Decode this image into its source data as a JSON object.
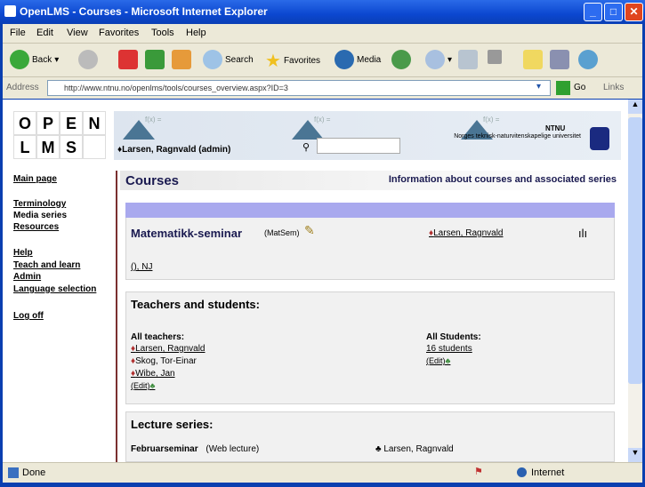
{
  "window": {
    "title": "OpenLMS - Courses - Microsoft Internet Explorer"
  },
  "menu": [
    "File",
    "Edit",
    "View",
    "Favorites",
    "Tools",
    "Help"
  ],
  "toolbar": {
    "back": "Back",
    "search": "Search",
    "favorites": "Favorites",
    "media": "Media"
  },
  "address": {
    "label": "Address",
    "url": "http://www.ntnu.no/openlms/tools/courses_overview.aspx?ID=3",
    "go": "Go",
    "links": "Links"
  },
  "header": {
    "user": "Larsen, Ragnvald (admin)",
    "org_short": "NTNU",
    "org_name": "Norges teknisk-naturvitenskapelige universitet",
    "formula": "f(x) =",
    "logo_letters": [
      "O",
      "P",
      "E",
      "N",
      "L",
      "M",
      "S"
    ]
  },
  "nav": {
    "items": [
      "Main page",
      "Terminology",
      "Media series",
      "Resources",
      "Help",
      "Teach and learn",
      "Admin",
      "Language selection",
      "Log off"
    ]
  },
  "page": {
    "title": "Courses",
    "info_link": "Information about courses and associated series"
  },
  "course": {
    "name": "Matematikk-seminar",
    "code": "(MatSem)",
    "owner": "Larsen, Ragnvald",
    "lang": "(), NJ"
  },
  "people": {
    "heading": "Teachers and students:",
    "teachers_label": "All teachers:",
    "teachers": [
      "Larsen, Ragnvald",
      "Skog, Tor-Einar",
      "Wibe, Jan"
    ],
    "add_teacher": "(Edit)",
    "students_label": "All Students:",
    "students_count": "16 students",
    "add_student": "(Edit)"
  },
  "lectures": {
    "heading": "Lecture series:",
    "rows": [
      {
        "name": "Februarseminar",
        "detail": "(Web lecture)",
        "owner": "Larsen, Ragnvald"
      }
    ]
  },
  "status": {
    "left": "Done",
    "zone": "Internet"
  }
}
